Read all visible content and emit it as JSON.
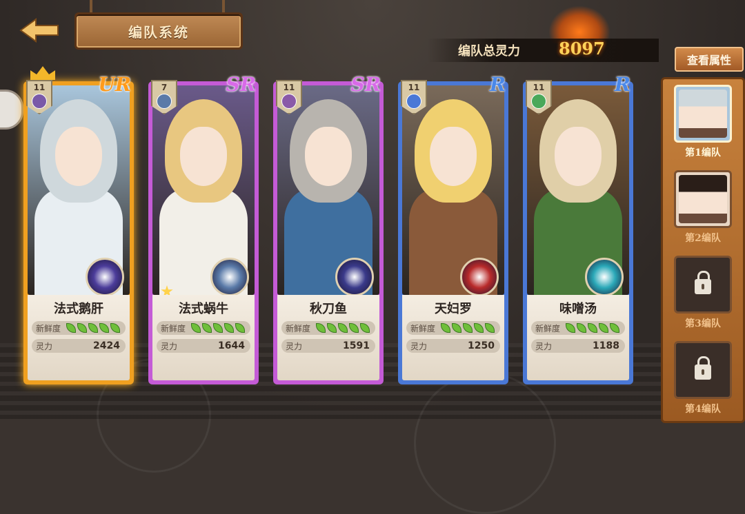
{
  "header": {
    "title": "编队系统",
    "total_power_label": "编队总灵力",
    "total_power_value": "8097",
    "view_attributes_label": "查看属性"
  },
  "cards": [
    {
      "name": "法式鹅肝",
      "rarity": "UR",
      "level": "11",
      "freshness_label": "新鲜度",
      "freshness": 5,
      "power_label": "灵力",
      "power": "2424",
      "leader": true,
      "colors": {
        "frame": "#f0a020",
        "hair": "#cfd8dc",
        "cloth": "#e8eef2",
        "bg": "#a9c6dc",
        "type": "#7a5aa8",
        "orb": "#4b3c9a"
      }
    },
    {
      "name": "法式蜗牛",
      "rarity": "SR",
      "level": "7",
      "freshness_label": "新鲜度",
      "freshness": 5,
      "power_label": "灵力",
      "power": "1644",
      "starred": true,
      "colors": {
        "frame": "#c45bd6",
        "hair": "#e8c780",
        "cloth": "#f2efe8",
        "bg": "#6a5a8a",
        "type": "#5a7aa8",
        "orb": "#5a7aa8"
      }
    },
    {
      "name": "秋刀鱼",
      "rarity": "SR",
      "level": "11",
      "freshness_label": "新鲜度",
      "freshness": 5,
      "power_label": "灵力",
      "power": "1591",
      "colors": {
        "frame": "#c45bd6",
        "hair": "#b8b4ae",
        "cloth": "#3f6f9f",
        "bg": "#6a6a86",
        "type": "#8a5aa8",
        "orb": "#3a3a8a"
      }
    },
    {
      "name": "天妇罗",
      "rarity": "R",
      "level": "11",
      "freshness_label": "新鲜度",
      "freshness": 5,
      "power_label": "灵力",
      "power": "1250",
      "colors": {
        "frame": "#4a78d6",
        "hair": "#f0d070",
        "cloth": "#8a5a3a",
        "bg": "#7a6a5a",
        "type": "#4a78d6",
        "orb": "#b82a2a"
      }
    },
    {
      "name": "味噌汤",
      "rarity": "R",
      "level": "11",
      "freshness_label": "新鲜度",
      "freshness": 5,
      "power_label": "灵力",
      "power": "1188",
      "colors": {
        "frame": "#4a78d6",
        "hair": "#e0cfa8",
        "cloth": "#4a7a3a",
        "bg": "#7a5a3a",
        "type": "#4aa85a",
        "orb": "#2aa8b8"
      }
    }
  ],
  "teams": [
    {
      "label": "第1编队",
      "state": "active"
    },
    {
      "label": "第2编队",
      "state": "available"
    },
    {
      "label": "第3编队",
      "state": "locked"
    },
    {
      "label": "第4编队",
      "state": "locked"
    }
  ]
}
